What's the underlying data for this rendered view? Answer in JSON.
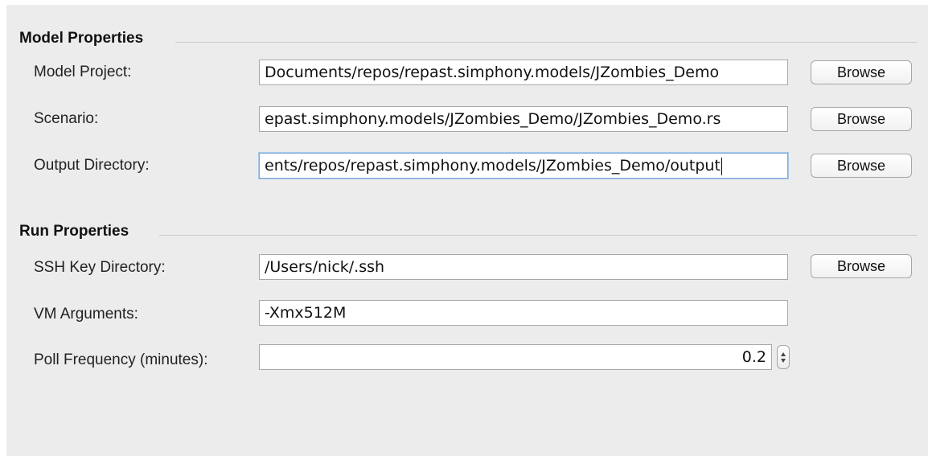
{
  "model_properties": {
    "title": "Model Properties",
    "model_project": {
      "label": "Model Project:",
      "value": "Documents/repos/repast.simphony.models/JZombies_Demo",
      "button": "Browse"
    },
    "scenario": {
      "label": "Scenario:",
      "value": "epast.simphony.models/JZombies_Demo/JZombies_Demo.rs",
      "button": "Browse"
    },
    "output_directory": {
      "label": "Output Directory:",
      "value": "ents/repos/repast.simphony.models/JZombies_Demo/output",
      "button": "Browse"
    }
  },
  "run_properties": {
    "title": "Run Properties",
    "ssh_key_directory": {
      "label": "SSH Key Directory:",
      "value": "/Users/nick/.ssh",
      "button": "Browse"
    },
    "vm_arguments": {
      "label": "VM Arguments:",
      "value": "-Xmx512M"
    },
    "poll_frequency": {
      "label": "Poll Frequency (minutes):",
      "value": "0.2"
    }
  },
  "icons": {
    "spinner": "up-down-stepper-icon"
  },
  "colors": {
    "panel_background": "#ececec",
    "focus_ring": "#7ea9d8"
  }
}
